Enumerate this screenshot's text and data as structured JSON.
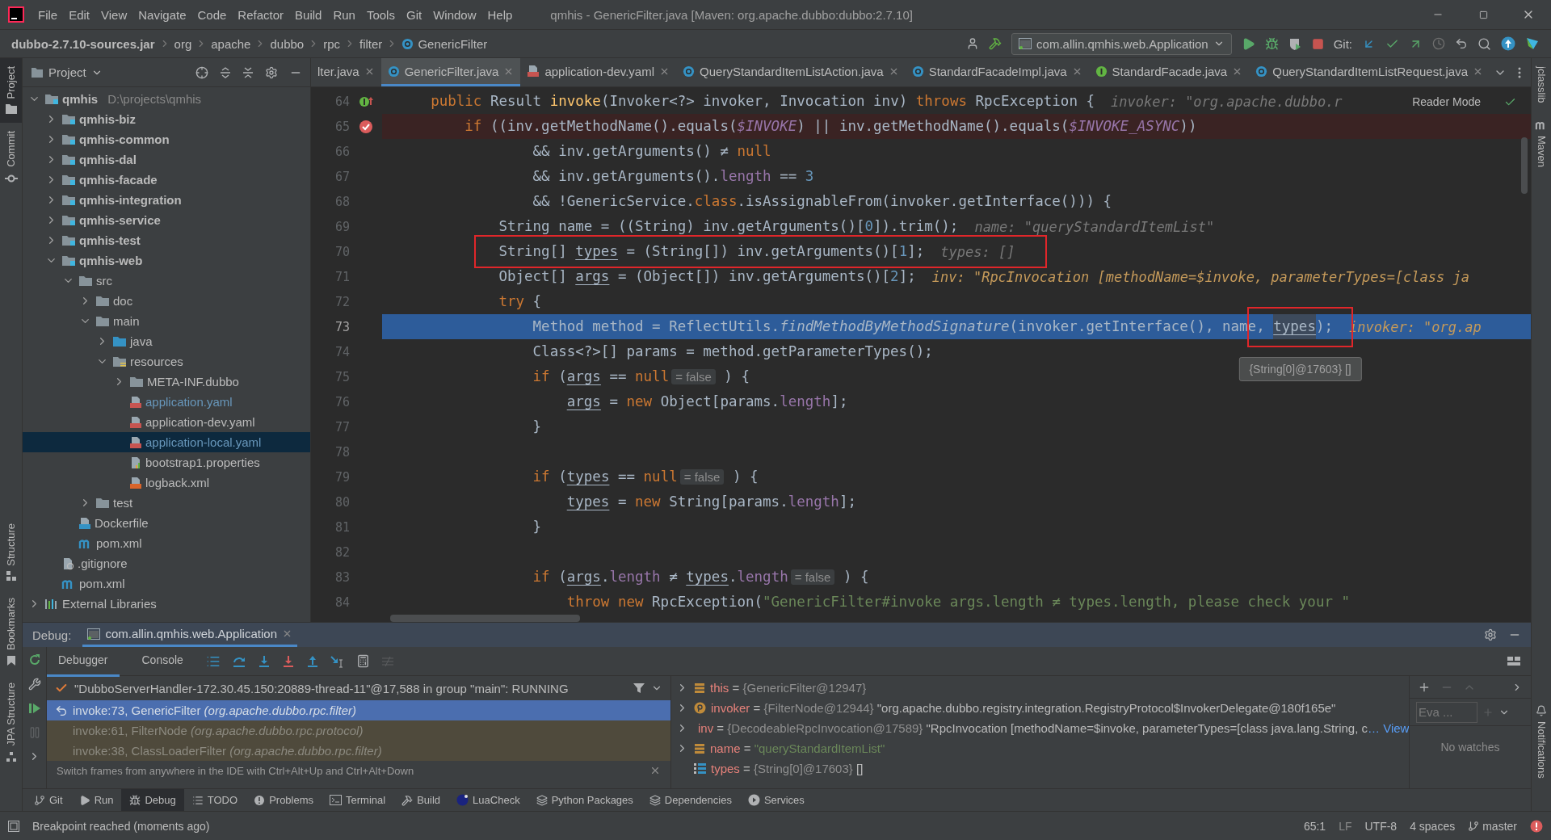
{
  "title_bar": {
    "menu": [
      "File",
      "Edit",
      "View",
      "Navigate",
      "Code",
      "Refactor",
      "Build",
      "Run",
      "Tools",
      "Git",
      "Window",
      "Help"
    ],
    "title": "qmhis - GenericFilter.java [Maven: org.apache.dubbo:dubbo:2.7.10]"
  },
  "nav_bar": {
    "breadcrumbs": [
      {
        "label": "dubbo-2.7.10-sources.jar",
        "kind": "jar"
      },
      {
        "label": "org",
        "kind": "package"
      },
      {
        "label": "apache",
        "kind": "package"
      },
      {
        "label": "dubbo",
        "kind": "package"
      },
      {
        "label": "rpc",
        "kind": "package"
      },
      {
        "label": "filter",
        "kind": "package"
      },
      {
        "label": "GenericFilter",
        "kind": "class"
      }
    ],
    "run_config": "com.allin.qmhis.web.Application",
    "vcs_label": "Git:"
  },
  "left_strip": {
    "top": [
      {
        "label": "Project",
        "kind": "project",
        "selected": true
      },
      {
        "label": "Commit",
        "kind": "commit",
        "selected": false
      }
    ],
    "bottom": [
      {
        "label": "Structure",
        "kind": "structure",
        "selected": false
      },
      {
        "label": "Bookmarks",
        "kind": "bookmarks",
        "selected": false
      },
      {
        "label": "JPA Structure",
        "kind": "jpa",
        "selected": false
      }
    ]
  },
  "right_strip": {
    "top": [
      {
        "label": "jclasslib",
        "kind": "plain"
      },
      {
        "label": "Maven",
        "kind": "maven"
      }
    ],
    "bottom": [
      {
        "label": "Notifications",
        "kind": "notifications"
      }
    ]
  },
  "project": {
    "title": "Project",
    "tree": [
      {
        "label": "qmhis",
        "kind": "module",
        "path": "D:\\projects\\qmhis",
        "expanded": true,
        "selected": false,
        "children": [
          {
            "label": "qmhis-biz",
            "kind": "module",
            "expanded": false,
            "selected": false
          },
          {
            "label": "qmhis-common",
            "kind": "module",
            "expanded": false,
            "selected": false
          },
          {
            "label": "qmhis-dal",
            "kind": "module",
            "expanded": false,
            "selected": false
          },
          {
            "label": "qmhis-facade",
            "kind": "module",
            "expanded": false,
            "selected": false
          },
          {
            "label": "qmhis-integration",
            "kind": "module",
            "expanded": false,
            "selected": false
          },
          {
            "label": "qmhis-service",
            "kind": "module",
            "expanded": false,
            "selected": false
          },
          {
            "label": "qmhis-test",
            "kind": "module",
            "expanded": false,
            "selected": false
          },
          {
            "label": "qmhis-web",
            "kind": "module",
            "expanded": true,
            "selected": false,
            "children": [
              {
                "label": "src",
                "kind": "folder",
                "expanded": true,
                "selected": false,
                "children": [
                  {
                    "label": "doc",
                    "kind": "folder",
                    "expanded": false,
                    "selected": false
                  },
                  {
                    "label": "main",
                    "kind": "folder",
                    "expanded": true,
                    "selected": false,
                    "children": [
                      {
                        "label": "java",
                        "kind": "source-folder",
                        "expanded": false,
                        "selected": false
                      },
                      {
                        "label": "resources",
                        "kind": "resource-folder",
                        "expanded": true,
                        "selected": false,
                        "children": [
                          {
                            "label": "META-INF.dubbo",
                            "kind": "folder",
                            "expanded": false,
                            "selected": false
                          },
                          {
                            "label": "application.yaml",
                            "kind": "yaml",
                            "modified": true,
                            "selected": false
                          },
                          {
                            "label": "application-dev.yaml",
                            "kind": "yaml",
                            "modified": false,
                            "selected": false
                          },
                          {
                            "label": "application-local.yaml",
                            "kind": "yaml",
                            "modified": true,
                            "selected": true
                          },
                          {
                            "label": "bootstrap1.properties",
                            "kind": "properties",
                            "modified": false,
                            "selected": false
                          },
                          {
                            "label": "logback.xml",
                            "kind": "xml",
                            "modified": false,
                            "selected": false
                          }
                        ]
                      }
                    ]
                  },
                  {
                    "label": "test",
                    "kind": "folder",
                    "expanded": false,
                    "selected": false
                  }
                ]
              },
              {
                "label": "Dockerfile",
                "kind": "docker",
                "modified": false,
                "selected": false
              },
              {
                "label": "pom.xml",
                "kind": "maven",
                "modified": false,
                "selected": false
              }
            ]
          },
          {
            "label": ".gitignore",
            "kind": "gitignore",
            "modified": false,
            "selected": false
          },
          {
            "label": "pom.xml",
            "kind": "maven",
            "modified": false,
            "selected": false
          }
        ]
      },
      {
        "label": "External Libraries",
        "kind": "libraries",
        "expanded": false,
        "selected": false
      }
    ]
  },
  "editor": {
    "tabs": [
      {
        "label": "lter.java",
        "kind": "none",
        "selected": false
      },
      {
        "label": "GenericFilter.java",
        "kind": "class",
        "selected": true
      },
      {
        "label": "application-dev.yaml",
        "kind": "yaml",
        "selected": false
      },
      {
        "label": "QueryStandardItemListAction.java",
        "kind": "class",
        "selected": false
      },
      {
        "label": "StandardFacadeImpl.java",
        "kind": "class",
        "selected": false
      },
      {
        "label": "StandardFacade.java",
        "kind": "interface",
        "selected": false
      },
      {
        "label": "QueryStandardItemListRequest.java",
        "kind": "class",
        "selected": false
      }
    ],
    "reader_mode": "Reader Mode",
    "lines": [
      {
        "number": "64",
        "implements": true,
        "breakpoint": false,
        "current": false,
        "boxed": false,
        "tokens": [
          {
            "kind": "kw",
            "text": "    public "
          },
          {
            "kind": "plain",
            "text": "Result "
          },
          {
            "kind": "decl",
            "text": "invoke"
          },
          {
            "kind": "plain",
            "text": "(Invoker<?> invoker, Invocation inv) "
          },
          {
            "kind": "kw",
            "text": "throws "
          },
          {
            "kind": "plain",
            "text": "RpcException {"
          },
          {
            "kind": "hint",
            "changed": false,
            "text": "invoker: \"org.apache.dubbo.r"
          }
        ]
      },
      {
        "number": "65",
        "implements": false,
        "breakpoint": true,
        "current": false,
        "boxed": false,
        "tokens": [
          {
            "kind": "kw",
            "text": "        if "
          },
          {
            "kind": "plain",
            "text": "((inv.getMethodName().equals("
          },
          {
            "kind": "const",
            "text": "$INVOKE"
          },
          {
            "kind": "plain",
            "text": ") || inv.getMethodName().equals("
          },
          {
            "kind": "const",
            "text": "$INVOKE_ASYNC"
          },
          {
            "kind": "plain",
            "text": "))"
          }
        ]
      },
      {
        "number": "66",
        "implements": false,
        "breakpoint": false,
        "current": false,
        "boxed": false,
        "tokens": [
          {
            "kind": "plain",
            "text": "                && inv.getArguments() ≠ "
          },
          {
            "kind": "kw",
            "text": "null"
          }
        ]
      },
      {
        "number": "67",
        "implements": false,
        "breakpoint": false,
        "current": false,
        "boxed": false,
        "tokens": [
          {
            "kind": "plain",
            "text": "                && inv.getArguments()."
          },
          {
            "kind": "field",
            "text": "length"
          },
          {
            "kind": "plain",
            "text": " == "
          },
          {
            "kind": "num",
            "text": "3"
          }
        ]
      },
      {
        "number": "68",
        "implements": false,
        "breakpoint": false,
        "current": false,
        "boxed": false,
        "tokens": [
          {
            "kind": "plain",
            "text": "                && !GenericService."
          },
          {
            "kind": "kw",
            "text": "class"
          },
          {
            "kind": "plain",
            "text": ".isAssignableFrom(invoker.getInterface())) {"
          }
        ]
      },
      {
        "number": "69",
        "implements": false,
        "breakpoint": false,
        "current": false,
        "boxed": false,
        "tokens": [
          {
            "kind": "plain",
            "text": "            String name = ((String) inv.getArguments()["
          },
          {
            "kind": "num",
            "text": "0"
          },
          {
            "kind": "plain",
            "text": "]).trim();"
          },
          {
            "kind": "hint",
            "changed": false,
            "text": "name: \"queryStandardItemList\""
          }
        ]
      },
      {
        "number": "70",
        "implements": false,
        "breakpoint": false,
        "current": false,
        "boxed": true,
        "tokens": [
          {
            "kind": "plain",
            "text": "            String[] "
          },
          {
            "kind": "var",
            "text": "types"
          },
          {
            "kind": "plain",
            "text": " = (String[]) inv.getArguments()["
          },
          {
            "kind": "num",
            "text": "1"
          },
          {
            "kind": "plain",
            "text": "];"
          },
          {
            "kind": "hint",
            "changed": false,
            "text": "types: []"
          }
        ]
      },
      {
        "number": "71",
        "implements": false,
        "breakpoint": false,
        "current": false,
        "boxed": false,
        "tokens": [
          {
            "kind": "plain",
            "text": "            Object[] "
          },
          {
            "kind": "var",
            "text": "args"
          },
          {
            "kind": "plain",
            "text": " = (Object[]) inv.getArguments()["
          },
          {
            "kind": "num",
            "text": "2"
          },
          {
            "kind": "plain",
            "text": "];"
          },
          {
            "kind": "hint",
            "changed": true,
            "text": "inv: \"RpcInvocation [methodName=$invoke, parameterTypes=[class ja"
          }
        ]
      },
      {
        "number": "72",
        "implements": false,
        "breakpoint": false,
        "current": false,
        "boxed": false,
        "tokens": [
          {
            "kind": "kw",
            "text": "            try"
          },
          {
            "kind": "plain",
            "text": " {"
          }
        ]
      },
      {
        "number": "73",
        "implements": false,
        "breakpoint": false,
        "current": true,
        "boxed": false,
        "tokens": [
          {
            "kind": "plain",
            "text": "                Method method = ReflectUtils."
          },
          {
            "kind": "method",
            "text": "findMethodByMethodSignature"
          },
          {
            "kind": "plain",
            "text": "(invoker.getInterface(), name, "
          },
          {
            "kind": "var",
            "text": "types",
            "boxed": true,
            "tooltip": "{String[0]@17603} []"
          },
          {
            "kind": "plain",
            "text": ");"
          },
          {
            "kind": "hint",
            "changed": true,
            "text": "invoker: \"org.ap"
          }
        ]
      },
      {
        "number": "74",
        "implements": false,
        "breakpoint": false,
        "current": false,
        "boxed": false,
        "tokens": [
          {
            "kind": "plain",
            "text": "                Class<?>[] params = method.getParameterTypes();"
          }
        ]
      },
      {
        "number": "75",
        "implements": false,
        "breakpoint": false,
        "current": false,
        "boxed": false,
        "tokens": [
          {
            "kind": "kw",
            "text": "                if "
          },
          {
            "kind": "plain",
            "text": "("
          },
          {
            "kind": "var",
            "text": "args"
          },
          {
            "kind": "plain",
            "text": " == "
          },
          {
            "kind": "kw",
            "text": "null"
          },
          {
            "kind": "value",
            "text": "= false"
          },
          {
            "kind": "plain",
            "text": " ) {"
          }
        ]
      },
      {
        "number": "76",
        "implements": false,
        "breakpoint": false,
        "current": false,
        "boxed": false,
        "tokens": [
          {
            "kind": "var",
            "text": "                    args"
          },
          {
            "kind": "plain",
            "text": " = "
          },
          {
            "kind": "kw",
            "text": "new "
          },
          {
            "kind": "plain",
            "text": "Object[params."
          },
          {
            "kind": "field",
            "text": "length"
          },
          {
            "kind": "plain",
            "text": "];"
          }
        ]
      },
      {
        "number": "77",
        "implements": false,
        "breakpoint": false,
        "current": false,
        "boxed": false,
        "tokens": [
          {
            "kind": "plain",
            "text": "                }"
          }
        ]
      },
      {
        "number": "78",
        "implements": false,
        "breakpoint": false,
        "current": false,
        "boxed": false
      },
      {
        "number": "79",
        "implements": false,
        "breakpoint": false,
        "current": false,
        "boxed": false,
        "tokens": [
          {
            "kind": "kw",
            "text": "                if "
          },
          {
            "kind": "plain",
            "text": "("
          },
          {
            "kind": "var",
            "text": "types"
          },
          {
            "kind": "plain",
            "text": " == "
          },
          {
            "kind": "kw",
            "text": "null"
          },
          {
            "kind": "value",
            "text": "= false"
          },
          {
            "kind": "plain",
            "text": " ) {"
          }
        ]
      },
      {
        "number": "80",
        "implements": false,
        "breakpoint": false,
        "current": false,
        "boxed": false,
        "tokens": [
          {
            "kind": "var",
            "text": "                    types"
          },
          {
            "kind": "plain",
            "text": " = "
          },
          {
            "kind": "kw",
            "text": "new "
          },
          {
            "kind": "plain",
            "text": "String[params."
          },
          {
            "kind": "field",
            "text": "length"
          },
          {
            "kind": "plain",
            "text": "];"
          }
        ]
      },
      {
        "number": "81",
        "implements": false,
        "breakpoint": false,
        "current": false,
        "boxed": false,
        "tokens": [
          {
            "kind": "plain",
            "text": "                }"
          }
        ]
      },
      {
        "number": "82",
        "implements": false,
        "breakpoint": false,
        "current": false,
        "boxed": false
      },
      {
        "number": "83",
        "implements": false,
        "breakpoint": false,
        "current": false,
        "boxed": false,
        "tokens": [
          {
            "kind": "kw",
            "text": "                if "
          },
          {
            "kind": "plain",
            "text": "("
          },
          {
            "kind": "var",
            "text": "args"
          },
          {
            "kind": "plain",
            "text": "."
          },
          {
            "kind": "field",
            "text": "length"
          },
          {
            "kind": "plain",
            "text": " ≠ "
          },
          {
            "kind": "var",
            "text": "types"
          },
          {
            "kind": "plain",
            "text": "."
          },
          {
            "kind": "field",
            "text": "length"
          },
          {
            "kind": "value",
            "text": "= false"
          },
          {
            "kind": "plain",
            "text": " ) {"
          }
        ]
      },
      {
        "number": "84",
        "implements": false,
        "breakpoint": false,
        "current": false,
        "boxed": false,
        "tokens": [
          {
            "kind": "kw",
            "text": "                    throw new "
          },
          {
            "kind": "plain",
            "text": "RpcException("
          },
          {
            "kind": "str",
            "text": "\"GenericFilter#invoke args.length ≠ types.length, please check your \""
          }
        ]
      }
    ]
  },
  "debug": {
    "label": "Debug:",
    "session": "com.allin.qmhis.web.Application",
    "tabs": [
      {
        "label": "Debugger",
        "selected": true
      },
      {
        "label": "Console",
        "selected": false
      }
    ],
    "thread": "\"DubboServerHandler-172.30.45.150:20889-thread-11\"@17,588 in group \"main\": RUNNING",
    "frames": [
      {
        "method": "invoke:73, GenericFilter",
        "package": "(org.apache.dubbo.rpc.filter)",
        "selected": true
      },
      {
        "method": "invoke:61, FilterNode",
        "package": "(org.apache.dubbo.rpc.protocol)",
        "selected": false
      },
      {
        "method": "invoke:38, ClassLoaderFilter",
        "package": "(org.apache.dubbo.rpc.filter)",
        "selected": false
      }
    ],
    "frames_hint": "Switch frames from anywhere in the IDE with Ctrl+Alt+Up and Ctrl+Alt+Down",
    "variables": [
      {
        "name": "this",
        "sep": "=",
        "type": "{GenericFilter@12947}",
        "kind": "field",
        "expandable": true
      },
      {
        "name": "invoker",
        "sep": "=",
        "type": "{FilterNode@12944}",
        "value": "\"org.apache.dubbo.registry.integration.RegistryProtocol$InvokerDelegate@180f165e\"",
        "string": false,
        "kind": "param",
        "expandable": true
      },
      {
        "name": "inv",
        "sep": "=",
        "type": "{DecodeableRpcInvocation@17589}",
        "value": "\"RpcInvocation [methodName=$invoke, parameterTypes=[class java.lang.String, c",
        "string": false,
        "link": "… View",
        "kind": "param",
        "expandable": true
      },
      {
        "name": "name",
        "sep": "=",
        "value": "\"queryStandardItemList\"",
        "string": true,
        "kind": "field",
        "expandable": true
      },
      {
        "name": "types",
        "sep": "=",
        "type": "{String[0]@17603}",
        "value": "[]",
        "string": false,
        "kind": "array",
        "expandable": false
      }
    ],
    "watches": {
      "placeholder": "Eva ...",
      "empty": "No watches"
    }
  },
  "tool_bar": [
    {
      "label": "Git",
      "kind": "git",
      "selected": false
    },
    {
      "label": "Run",
      "kind": "run",
      "selected": false
    },
    {
      "label": "Debug",
      "kind": "debug",
      "selected": true
    },
    {
      "label": "TODO",
      "kind": "todo",
      "selected": false
    },
    {
      "label": "Problems",
      "kind": "problems",
      "selected": false
    },
    {
      "label": "Terminal",
      "kind": "terminal",
      "selected": false
    },
    {
      "label": "Build",
      "kind": "build",
      "selected": false
    },
    {
      "label": "LuaCheck",
      "kind": "luacheck",
      "selected": false
    },
    {
      "label": "Python Packages",
      "kind": "packages",
      "selected": false
    },
    {
      "label": "Dependencies",
      "kind": "dependencies",
      "selected": false
    },
    {
      "label": "Services",
      "kind": "services",
      "selected": false
    }
  ],
  "status_bar": {
    "message": "Breakpoint reached (moments ago)",
    "position": "65:1",
    "line_separator": "LF",
    "encoding": "UTF-8",
    "indent": "4 spaces",
    "branch": "master"
  }
}
